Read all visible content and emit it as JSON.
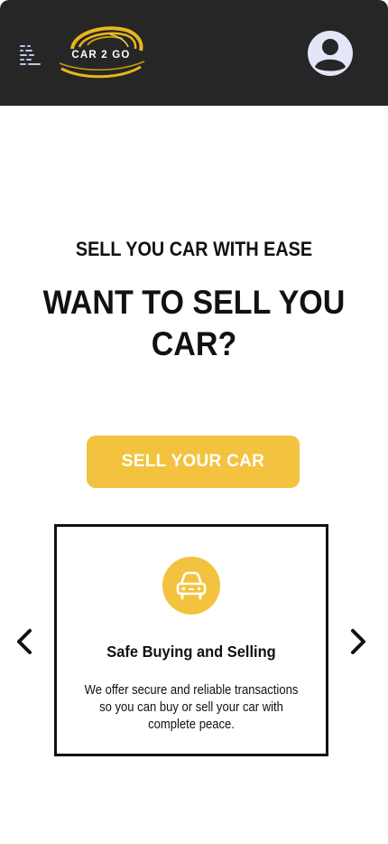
{
  "header": {
    "menu_icon": "menu-icon",
    "logo_text": "CAR 2 GO",
    "avatar_icon": "user-avatar-icon",
    "colors": {
      "background": "#262626",
      "logo_gold": "#e8b61c",
      "avatar": "#e3e6f6"
    }
  },
  "hero": {
    "subtitle": "SELL YOU CAR WITH EASE",
    "title": "WANT TO SELL YOU CAR?",
    "cta_label": "SELL YOUR CAR",
    "accent_color": "#f3c33f"
  },
  "carousel": {
    "prev_icon": "chevron-left-icon",
    "next_icon": "chevron-right-icon",
    "card": {
      "icon": "car-icon",
      "title": "Safe Buying and Selling",
      "text": "We offer secure and reliable transactions so you can buy or sell your car with complete peace."
    }
  }
}
